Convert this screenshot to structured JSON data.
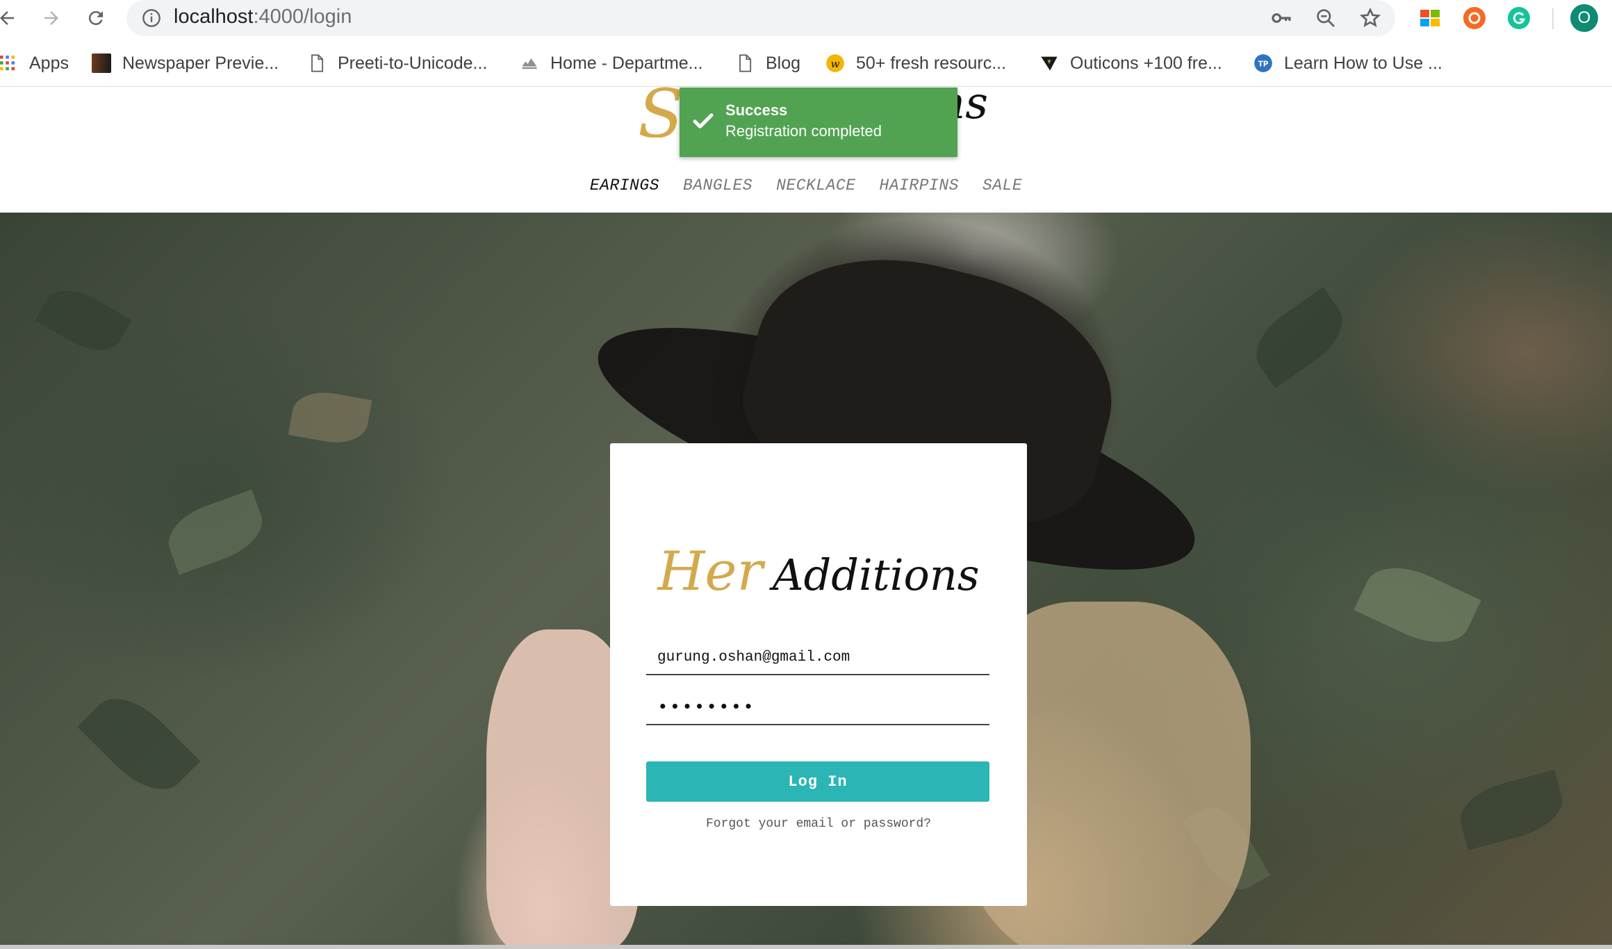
{
  "browser": {
    "url_host": "localhost",
    "url_path": ":4000/login",
    "avatar_letter": "O",
    "bookmarks": [
      {
        "label": "Apps",
        "icon": "apps-grid-icon"
      },
      {
        "label": "Newspaper Previe...",
        "icon": "newspaper-favicon"
      },
      {
        "label": "Preeti-to-Unicode...",
        "icon": "page-icon"
      },
      {
        "label": "Home - Departme...",
        "icon": "department-favicon"
      },
      {
        "label": "Blog",
        "icon": "page-icon"
      },
      {
        "label": "50+ fresh resourc...",
        "icon": "resources-favicon"
      },
      {
        "label": "Outicons +100 fre...",
        "icon": "outicons-favicon"
      },
      {
        "label": "Learn How to Use ...",
        "icon": "tp-favicon"
      }
    ]
  },
  "site": {
    "menu": [
      {
        "label": "EARINGS",
        "active": true
      },
      {
        "label": "BANGLES",
        "active": false
      },
      {
        "label": "NECKLACE",
        "active": false
      },
      {
        "label": "HAIRPINS",
        "active": false
      },
      {
        "label": "SALE",
        "active": false
      }
    ]
  },
  "toast": {
    "title": "Success",
    "message": "Registration completed",
    "color": "#51a351"
  },
  "login": {
    "brand_part1": "Her",
    "brand_part2": "Additions",
    "email_value": "gurung.oshan@gmail.com",
    "password_value": "••••••••",
    "button_label": "Log In",
    "forgot_label": "Forgot your email or password?",
    "accent_color": "#2bb5b5",
    "brand_gold": "#d4a94c"
  }
}
